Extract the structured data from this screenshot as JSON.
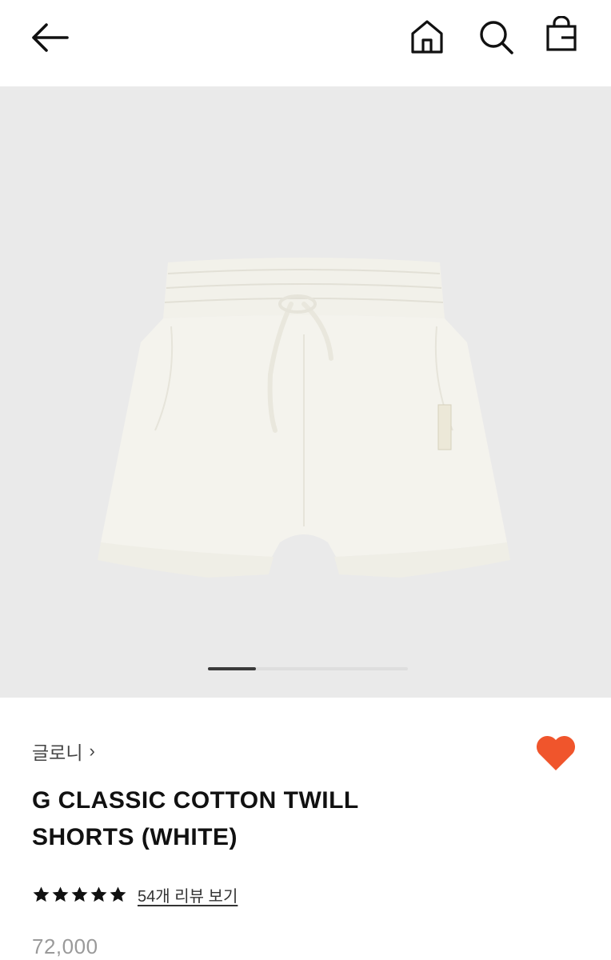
{
  "header": {
    "back_icon": "arrow-left-icon",
    "home_icon": "home-icon",
    "search_icon": "search-icon",
    "bag_icon": "shopping-bag-icon"
  },
  "gallery": {
    "image_description": "white shorts",
    "current_slide_fraction": 0.24,
    "background": "#eaeaea"
  },
  "product": {
    "brand": "글로니",
    "brand_chevron": "›",
    "title_line1": "G CLASSIC COTTON TWILL",
    "title_line2": "SHORTS (WHITE)",
    "rating_stars": 5,
    "review_link": "54개 리뷰 보기",
    "price": "72,000",
    "wishlist_color": "#f0552c",
    "wishlisted": true
  }
}
